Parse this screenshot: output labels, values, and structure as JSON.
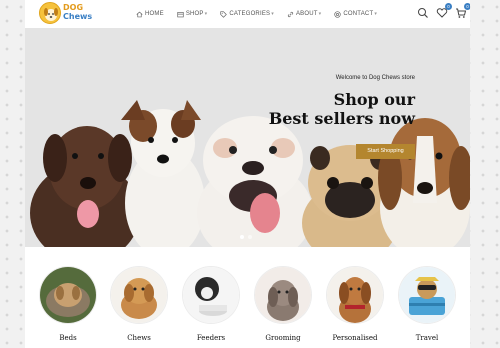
{
  "logo": {
    "line1": "DOG",
    "line2": "Chews"
  },
  "nav": [
    {
      "label": "HOME",
      "icon": "home-icon"
    },
    {
      "label": "SHOP",
      "icon": "shop-icon"
    },
    {
      "label": "CATEGORIES",
      "icon": "tag-icon"
    },
    {
      "label": "ABOUT",
      "icon": "link-icon"
    },
    {
      "label": "CONTACT",
      "icon": "at-icon"
    }
  ],
  "header_icons": {
    "wishlist_count": "0",
    "cart_count": "0"
  },
  "hero": {
    "kicker": "Welcome to Dog Chews store",
    "title_line1": "Shop our",
    "title_line2": "Best sellers now",
    "button": "Start Shopping"
  },
  "categories": [
    {
      "label": "Beds"
    },
    {
      "label": "Chews"
    },
    {
      "label": "Feeders"
    },
    {
      "label": "Grooming"
    },
    {
      "label": "Personalised"
    },
    {
      "label": "Travel"
    }
  ]
}
